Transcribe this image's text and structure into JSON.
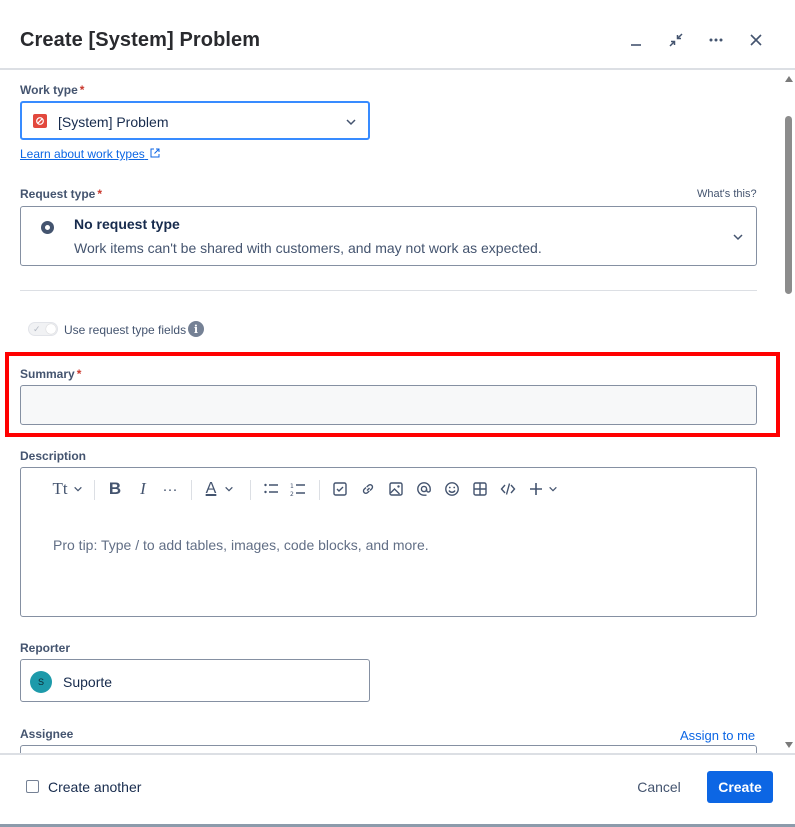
{
  "header": {
    "title": "Create [System] Problem"
  },
  "work_type": {
    "label": "Work type",
    "required": "*",
    "value": "[System] Problem",
    "learn_link": "Learn about work types"
  },
  "request_type": {
    "label": "Request type",
    "required": "*",
    "help": "What's this?",
    "title": "No request type",
    "subtitle": "Work items can't be shared with customers, and may not work as expected."
  },
  "toggle": {
    "label": "Use request type fields",
    "info": "i"
  },
  "summary": {
    "label": "Summary",
    "required": "*",
    "value": ""
  },
  "description": {
    "label": "Description",
    "placeholder": "Pro tip: Type / to add tables, images, code blocks, and more.",
    "toolbar": {
      "text_style": "Tt",
      "bold": "B",
      "italic": "I",
      "more": "···",
      "text_color": "A"
    }
  },
  "reporter": {
    "label": "Reporter",
    "avatar_initial": "S",
    "name": "Suporte"
  },
  "assignee": {
    "label": "Assignee",
    "assign_to_me": "Assign to me"
  },
  "footer": {
    "create_another": "Create another",
    "cancel": "Cancel",
    "create": "Create"
  },
  "colors": {
    "primary": "#0c66e4",
    "focus": "#388bff",
    "required": "#c9372c",
    "highlight": "#ff0000",
    "problem_icon": "#e2483d"
  }
}
